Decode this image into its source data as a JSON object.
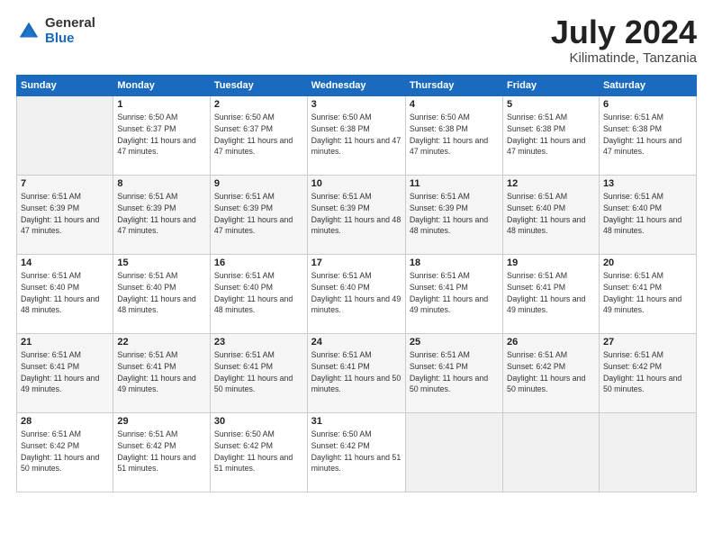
{
  "logo": {
    "general": "General",
    "blue": "Blue"
  },
  "title": {
    "month": "July 2024",
    "location": "Kilimatinde, Tanzania"
  },
  "calendar": {
    "headers": [
      "Sunday",
      "Monday",
      "Tuesday",
      "Wednesday",
      "Thursday",
      "Friday",
      "Saturday"
    ],
    "weeks": [
      [
        {
          "date": "",
          "sunrise": "",
          "sunset": "",
          "daylight": ""
        },
        {
          "date": "1",
          "sunrise": "Sunrise: 6:50 AM",
          "sunset": "Sunset: 6:37 PM",
          "daylight": "Daylight: 11 hours and 47 minutes."
        },
        {
          "date": "2",
          "sunrise": "Sunrise: 6:50 AM",
          "sunset": "Sunset: 6:37 PM",
          "daylight": "Daylight: 11 hours and 47 minutes."
        },
        {
          "date": "3",
          "sunrise": "Sunrise: 6:50 AM",
          "sunset": "Sunset: 6:38 PM",
          "daylight": "Daylight: 11 hours and 47 minutes."
        },
        {
          "date": "4",
          "sunrise": "Sunrise: 6:50 AM",
          "sunset": "Sunset: 6:38 PM",
          "daylight": "Daylight: 11 hours and 47 minutes."
        },
        {
          "date": "5",
          "sunrise": "Sunrise: 6:51 AM",
          "sunset": "Sunset: 6:38 PM",
          "daylight": "Daylight: 11 hours and 47 minutes."
        },
        {
          "date": "6",
          "sunrise": "Sunrise: 6:51 AM",
          "sunset": "Sunset: 6:38 PM",
          "daylight": "Daylight: 11 hours and 47 minutes."
        }
      ],
      [
        {
          "date": "7",
          "sunrise": "Sunrise: 6:51 AM",
          "sunset": "Sunset: 6:39 PM",
          "daylight": "Daylight: 11 hours and 47 minutes."
        },
        {
          "date": "8",
          "sunrise": "Sunrise: 6:51 AM",
          "sunset": "Sunset: 6:39 PM",
          "daylight": "Daylight: 11 hours and 47 minutes."
        },
        {
          "date": "9",
          "sunrise": "Sunrise: 6:51 AM",
          "sunset": "Sunset: 6:39 PM",
          "daylight": "Daylight: 11 hours and 47 minutes."
        },
        {
          "date": "10",
          "sunrise": "Sunrise: 6:51 AM",
          "sunset": "Sunset: 6:39 PM",
          "daylight": "Daylight: 11 hours and 48 minutes."
        },
        {
          "date": "11",
          "sunrise": "Sunrise: 6:51 AM",
          "sunset": "Sunset: 6:39 PM",
          "daylight": "Daylight: 11 hours and 48 minutes."
        },
        {
          "date": "12",
          "sunrise": "Sunrise: 6:51 AM",
          "sunset": "Sunset: 6:40 PM",
          "daylight": "Daylight: 11 hours and 48 minutes."
        },
        {
          "date": "13",
          "sunrise": "Sunrise: 6:51 AM",
          "sunset": "Sunset: 6:40 PM",
          "daylight": "Daylight: 11 hours and 48 minutes."
        }
      ],
      [
        {
          "date": "14",
          "sunrise": "Sunrise: 6:51 AM",
          "sunset": "Sunset: 6:40 PM",
          "daylight": "Daylight: 11 hours and 48 minutes."
        },
        {
          "date": "15",
          "sunrise": "Sunrise: 6:51 AM",
          "sunset": "Sunset: 6:40 PM",
          "daylight": "Daylight: 11 hours and 48 minutes."
        },
        {
          "date": "16",
          "sunrise": "Sunrise: 6:51 AM",
          "sunset": "Sunset: 6:40 PM",
          "daylight": "Daylight: 11 hours and 48 minutes."
        },
        {
          "date": "17",
          "sunrise": "Sunrise: 6:51 AM",
          "sunset": "Sunset: 6:40 PM",
          "daylight": "Daylight: 11 hours and 49 minutes."
        },
        {
          "date": "18",
          "sunrise": "Sunrise: 6:51 AM",
          "sunset": "Sunset: 6:41 PM",
          "daylight": "Daylight: 11 hours and 49 minutes."
        },
        {
          "date": "19",
          "sunrise": "Sunrise: 6:51 AM",
          "sunset": "Sunset: 6:41 PM",
          "daylight": "Daylight: 11 hours and 49 minutes."
        },
        {
          "date": "20",
          "sunrise": "Sunrise: 6:51 AM",
          "sunset": "Sunset: 6:41 PM",
          "daylight": "Daylight: 11 hours and 49 minutes."
        }
      ],
      [
        {
          "date": "21",
          "sunrise": "Sunrise: 6:51 AM",
          "sunset": "Sunset: 6:41 PM",
          "daylight": "Daylight: 11 hours and 49 minutes."
        },
        {
          "date": "22",
          "sunrise": "Sunrise: 6:51 AM",
          "sunset": "Sunset: 6:41 PM",
          "daylight": "Daylight: 11 hours and 49 minutes."
        },
        {
          "date": "23",
          "sunrise": "Sunrise: 6:51 AM",
          "sunset": "Sunset: 6:41 PM",
          "daylight": "Daylight: 11 hours and 50 minutes."
        },
        {
          "date": "24",
          "sunrise": "Sunrise: 6:51 AM",
          "sunset": "Sunset: 6:41 PM",
          "daylight": "Daylight: 11 hours and 50 minutes."
        },
        {
          "date": "25",
          "sunrise": "Sunrise: 6:51 AM",
          "sunset": "Sunset: 6:41 PM",
          "daylight": "Daylight: 11 hours and 50 minutes."
        },
        {
          "date": "26",
          "sunrise": "Sunrise: 6:51 AM",
          "sunset": "Sunset: 6:42 PM",
          "daylight": "Daylight: 11 hours and 50 minutes."
        },
        {
          "date": "27",
          "sunrise": "Sunrise: 6:51 AM",
          "sunset": "Sunset: 6:42 PM",
          "daylight": "Daylight: 11 hours and 50 minutes."
        }
      ],
      [
        {
          "date": "28",
          "sunrise": "Sunrise: 6:51 AM",
          "sunset": "Sunset: 6:42 PM",
          "daylight": "Daylight: 11 hours and 50 minutes."
        },
        {
          "date": "29",
          "sunrise": "Sunrise: 6:51 AM",
          "sunset": "Sunset: 6:42 PM",
          "daylight": "Daylight: 11 hours and 51 minutes."
        },
        {
          "date": "30",
          "sunrise": "Sunrise: 6:50 AM",
          "sunset": "Sunset: 6:42 PM",
          "daylight": "Daylight: 11 hours and 51 minutes."
        },
        {
          "date": "31",
          "sunrise": "Sunrise: 6:50 AM",
          "sunset": "Sunset: 6:42 PM",
          "daylight": "Daylight: 11 hours and 51 minutes."
        },
        {
          "date": "",
          "sunrise": "",
          "sunset": "",
          "daylight": ""
        },
        {
          "date": "",
          "sunrise": "",
          "sunset": "",
          "daylight": ""
        },
        {
          "date": "",
          "sunrise": "",
          "sunset": "",
          "daylight": ""
        }
      ]
    ]
  }
}
